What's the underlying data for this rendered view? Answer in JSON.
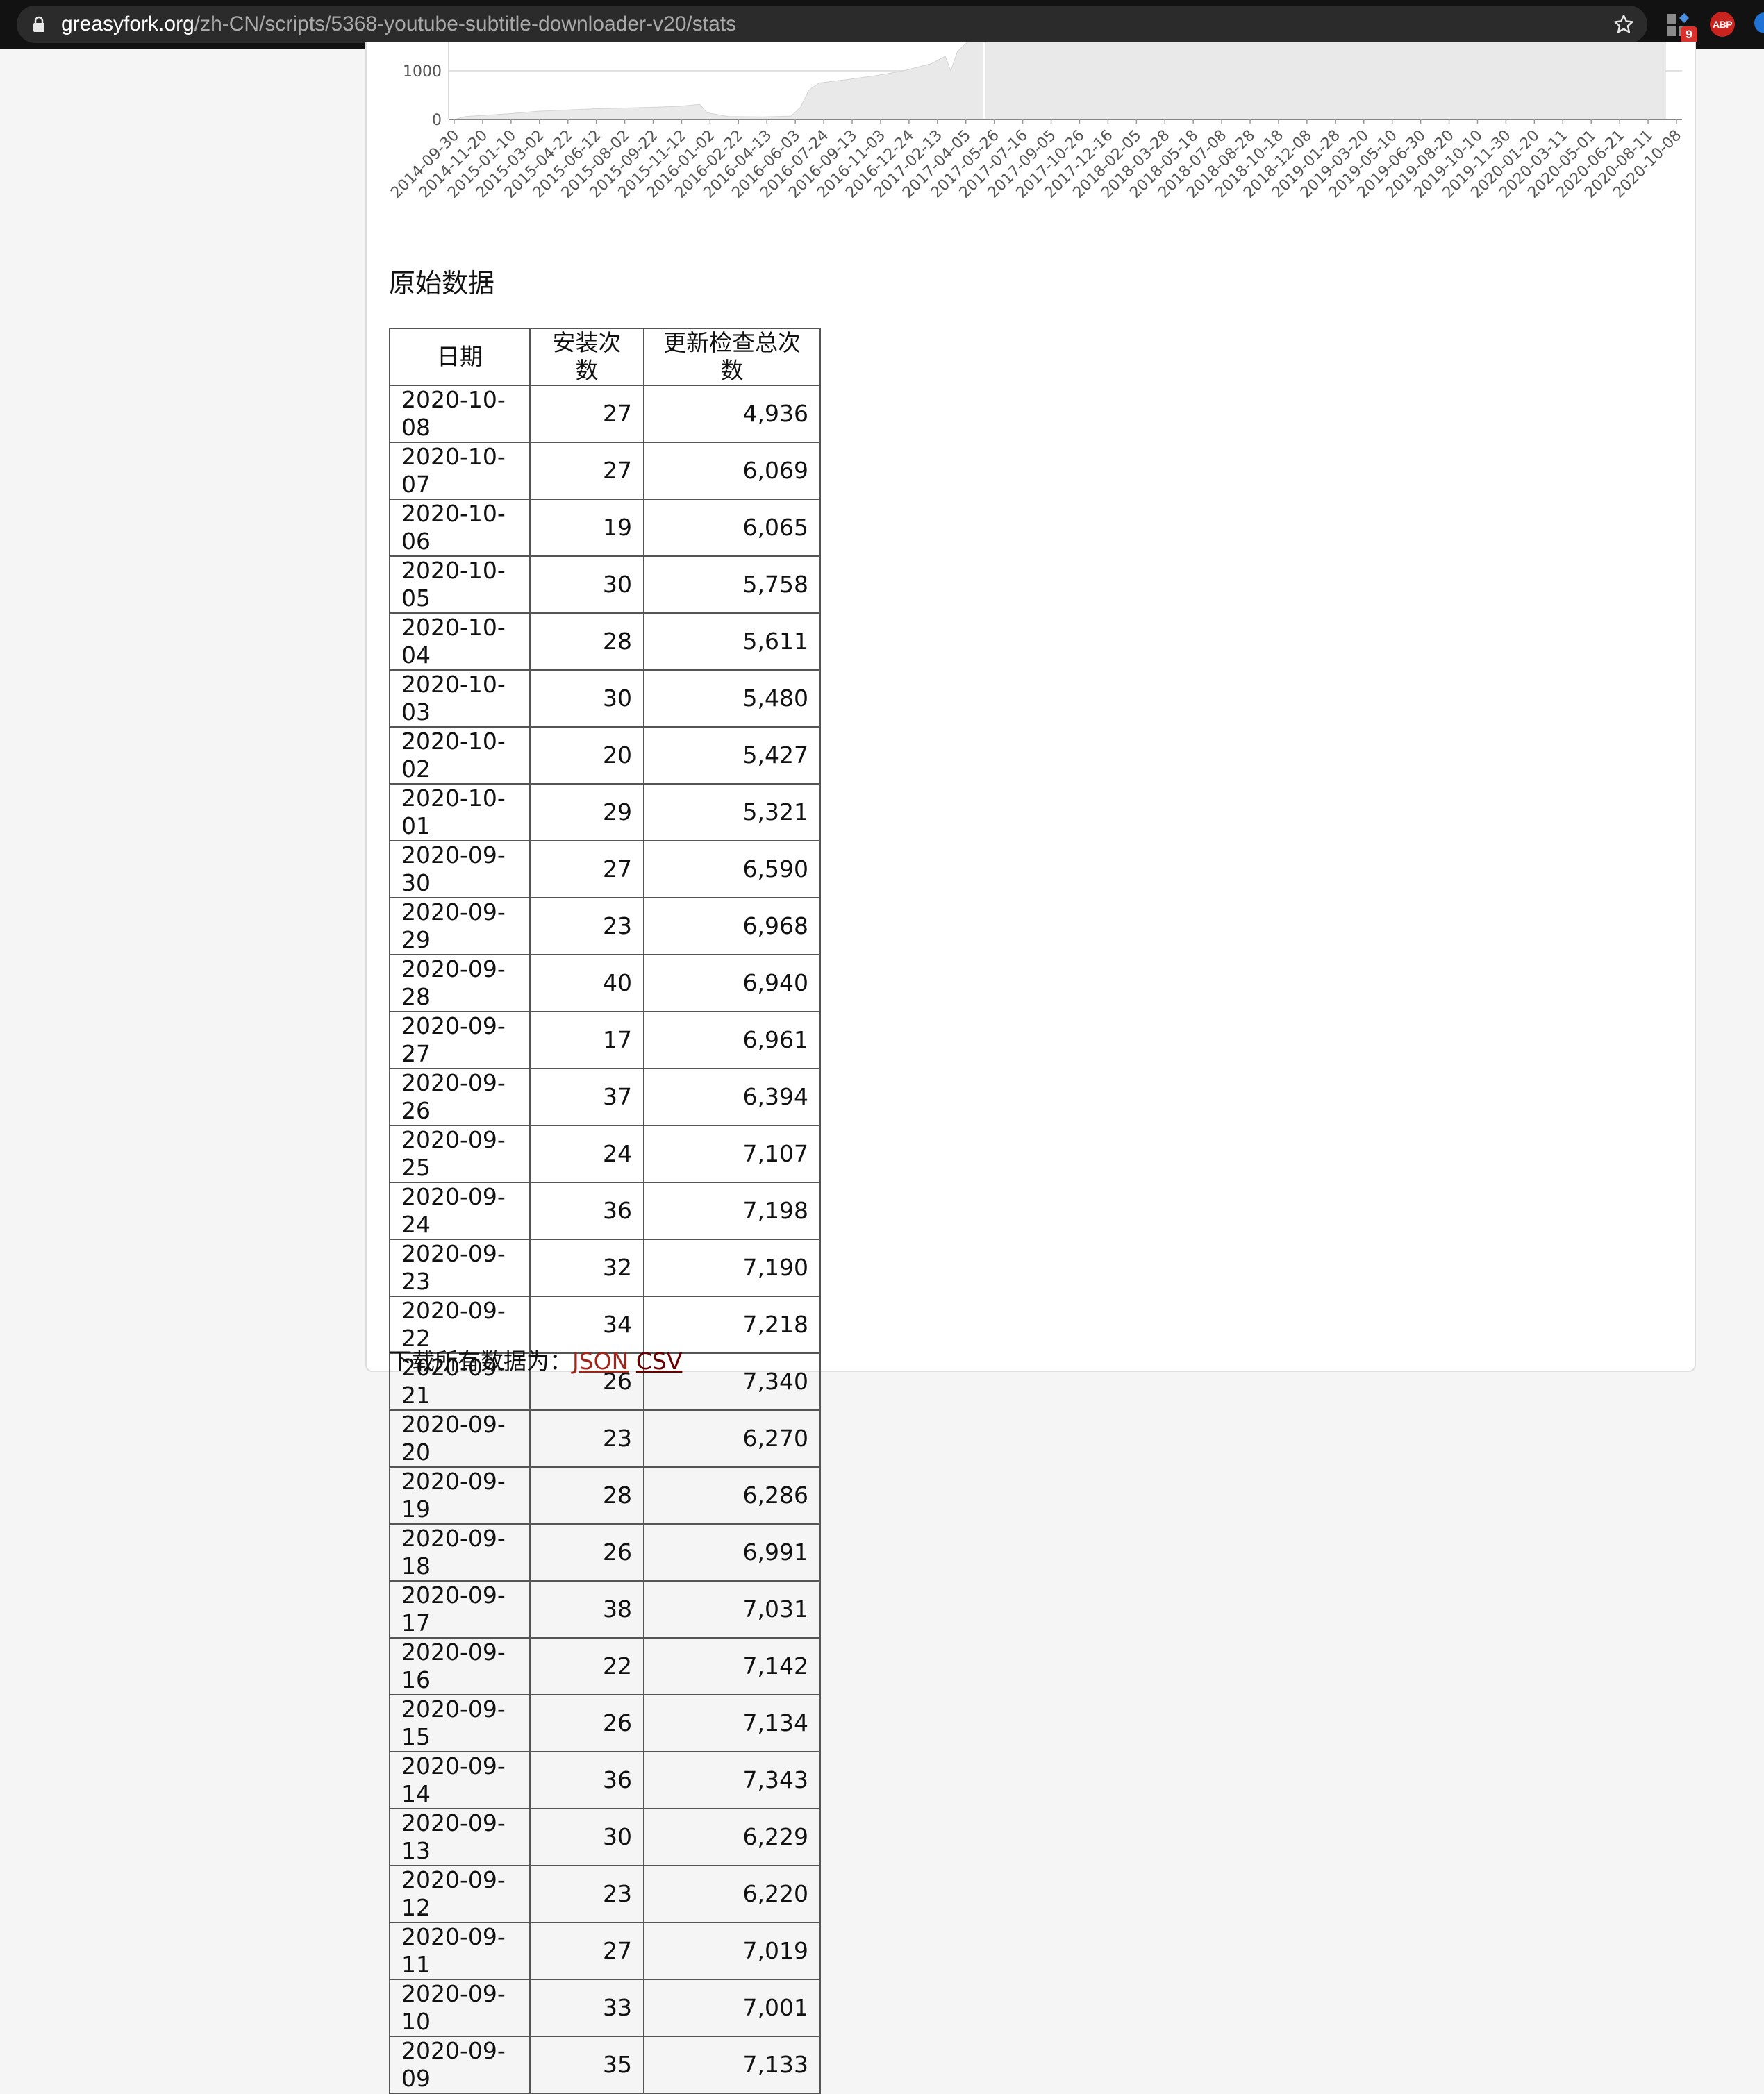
{
  "browser": {
    "url_host": "greasyfork.org",
    "url_path": "/zh-CN/scripts/5368-youtube-subtitle-downloader-v20/stats",
    "extension_badge": "9",
    "abp_label": "ABP"
  },
  "chart_data": {
    "type": "area",
    "y_ticks": [
      "0",
      "1000"
    ],
    "x_ticks": [
      "2014-09-30",
      "2014-11-20",
      "2015-01-10",
      "2015-03-02",
      "2015-04-22",
      "2015-06-12",
      "2015-08-02",
      "2015-09-22",
      "2015-11-12",
      "2016-01-02",
      "2016-02-22",
      "2016-04-13",
      "2016-06-03",
      "2016-07-24",
      "2016-09-13",
      "2016-11-03",
      "2016-12-24",
      "2017-02-13",
      "2017-04-05",
      "2017-05-26",
      "2017-07-16",
      "2017-09-05",
      "2017-10-26",
      "2017-12-16",
      "2018-02-05",
      "2018-03-28",
      "2018-05-18",
      "2018-07-08",
      "2018-08-28",
      "2018-10-18",
      "2018-12-08",
      "2019-01-28",
      "2019-03-20",
      "2019-05-10",
      "2019-06-30",
      "2019-08-20",
      "2019-10-10",
      "2019-11-30",
      "2020-01-20",
      "2020-03-11",
      "2020-05-01",
      "2020-06-21",
      "2020-08-11",
      "2020-10-08"
    ],
    "profile": [
      [
        "2014-09-30",
        0
      ],
      [
        "2014-10-20",
        60
      ],
      [
        "2015-01-10",
        120
      ],
      [
        "2015-03-02",
        170
      ],
      [
        "2015-06-12",
        220
      ],
      [
        "2015-09-22",
        250
      ],
      [
        "2015-11-12",
        270
      ],
      [
        "2015-12-20",
        310
      ],
      [
        "2016-01-02",
        140
      ],
      [
        "2016-02-10",
        60
      ],
      [
        "2016-04-13",
        55
      ],
      [
        "2016-06-03",
        70
      ],
      [
        "2016-06-20",
        250
      ],
      [
        "2016-07-05",
        600
      ],
      [
        "2016-07-24",
        750
      ],
      [
        "2016-09-13",
        820
      ],
      [
        "2016-11-03",
        900
      ],
      [
        "2016-12-24",
        1000
      ],
      [
        "2017-02-13",
        1150
      ],
      [
        "2017-03-10",
        1300
      ],
      [
        "2017-03-20",
        1000
      ],
      [
        "2017-04-01",
        1400
      ],
      [
        "2017-04-20",
        1600
      ],
      [
        "2017-05-20",
        1800
      ],
      [
        "2017-05-26",
        1900
      ],
      [
        "2020-10-08",
        1900
      ]
    ]
  },
  "raw_section": {
    "title": "原始数据",
    "headers": [
      "日期",
      "安装次数",
      "更新检查总次数"
    ],
    "rows": [
      [
        "2020-10-08",
        "27",
        "4,936"
      ],
      [
        "2020-10-07",
        "27",
        "6,069"
      ],
      [
        "2020-10-06",
        "19",
        "6,065"
      ],
      [
        "2020-10-05",
        "30",
        "5,758"
      ],
      [
        "2020-10-04",
        "28",
        "5,611"
      ],
      [
        "2020-10-03",
        "30",
        "5,480"
      ],
      [
        "2020-10-02",
        "20",
        "5,427"
      ],
      [
        "2020-10-01",
        "29",
        "5,321"
      ],
      [
        "2020-09-30",
        "27",
        "6,590"
      ],
      [
        "2020-09-29",
        "23",
        "6,968"
      ],
      [
        "2020-09-28",
        "40",
        "6,940"
      ],
      [
        "2020-09-27",
        "17",
        "6,961"
      ],
      [
        "2020-09-26",
        "37",
        "6,394"
      ],
      [
        "2020-09-25",
        "24",
        "7,107"
      ],
      [
        "2020-09-24",
        "36",
        "7,198"
      ],
      [
        "2020-09-23",
        "32",
        "7,190"
      ],
      [
        "2020-09-22",
        "34",
        "7,218"
      ],
      [
        "2020-09-21",
        "26",
        "7,340"
      ],
      [
        "2020-09-20",
        "23",
        "6,270"
      ],
      [
        "2020-09-19",
        "28",
        "6,286"
      ],
      [
        "2020-09-18",
        "26",
        "6,991"
      ],
      [
        "2020-09-17",
        "38",
        "7,031"
      ],
      [
        "2020-09-16",
        "22",
        "7,142"
      ],
      [
        "2020-09-15",
        "26",
        "7,134"
      ],
      [
        "2020-09-14",
        "36",
        "7,343"
      ],
      [
        "2020-09-13",
        "30",
        "6,229"
      ],
      [
        "2020-09-12",
        "23",
        "6,220"
      ],
      [
        "2020-09-11",
        "27",
        "7,019"
      ],
      [
        "2020-09-10",
        "33",
        "7,001"
      ],
      [
        "2020-09-09",
        "35",
        "7,133"
      ]
    ],
    "download_prefix": "下载所有数据为：",
    "json_link": "JSON",
    "csv_link": "CSV"
  }
}
